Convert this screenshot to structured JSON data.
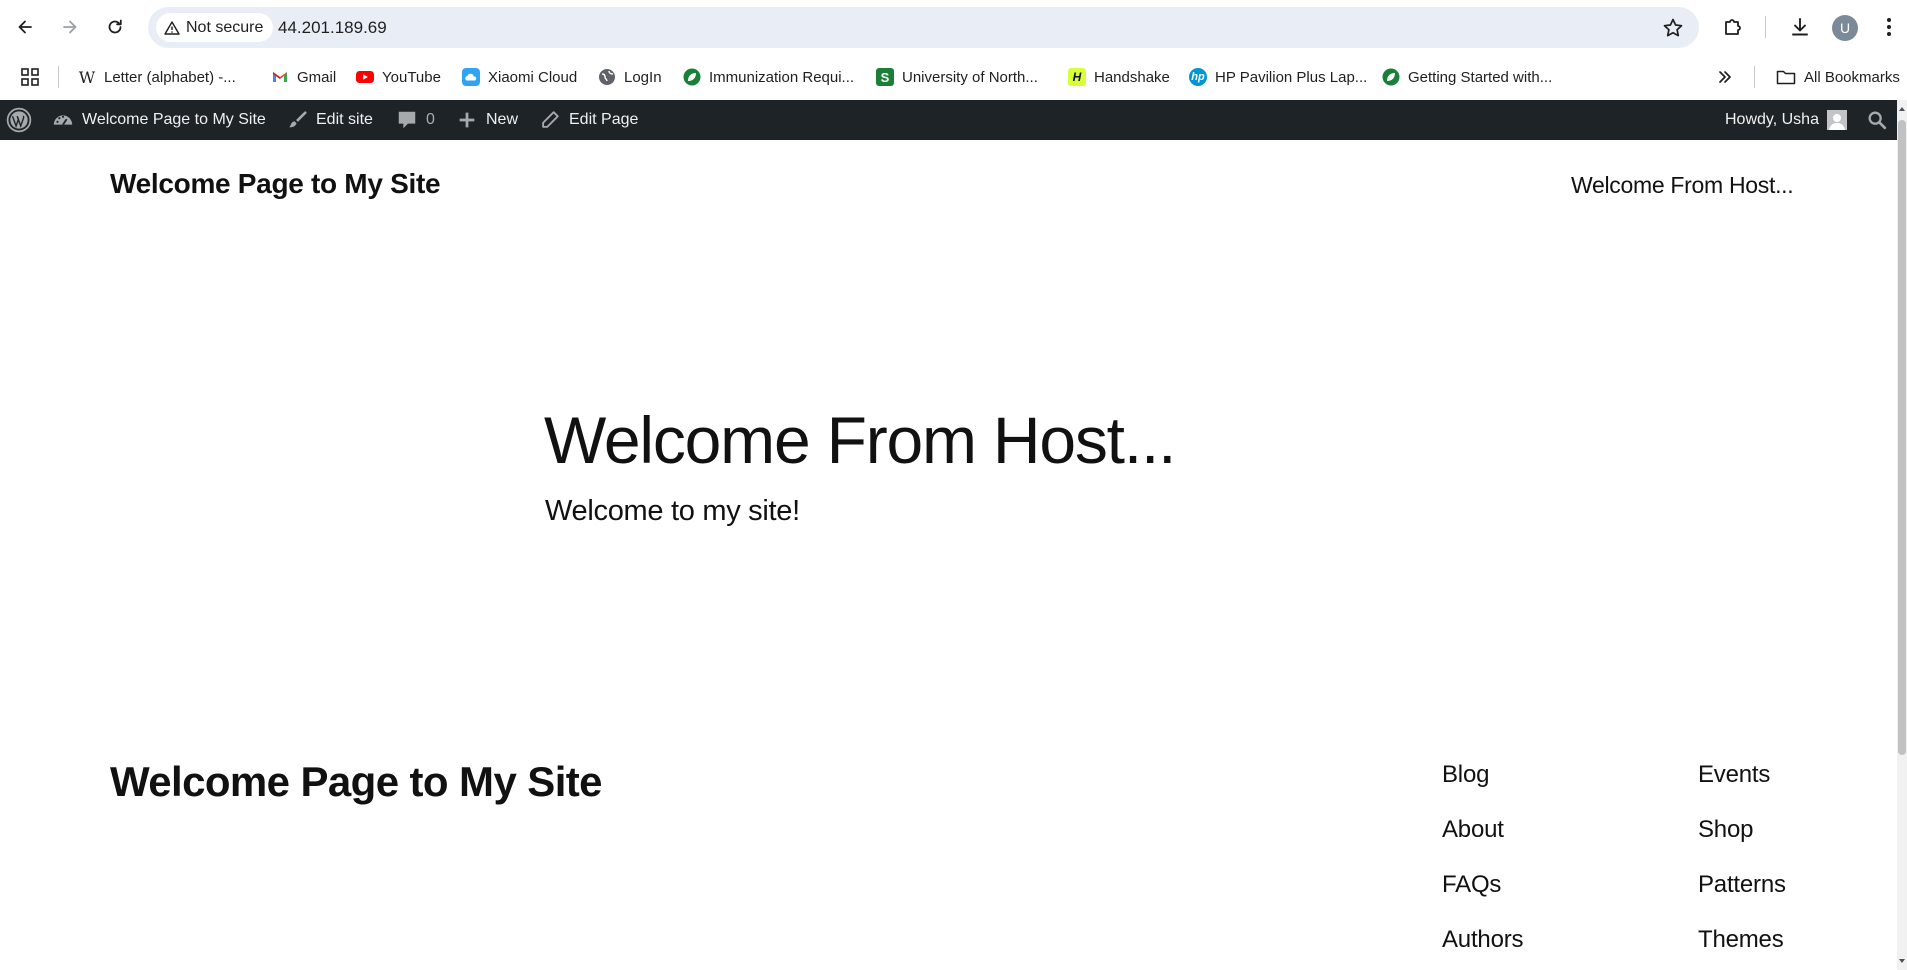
{
  "browser": {
    "security_label": "Not secure",
    "url": "44.201.189.69",
    "avatar_letter": "U"
  },
  "bookmarks": {
    "items": [
      {
        "label": "Letter (alphabet) -...",
        "icon": "wikipedia-icon"
      },
      {
        "label": "Gmail",
        "icon": "gmail-icon"
      },
      {
        "label": "YouTube",
        "icon": "youtube-icon"
      },
      {
        "label": "Xiaomi Cloud",
        "icon": "xiaomi-cloud-icon"
      },
      {
        "label": "LogIn",
        "icon": "globe-icon"
      },
      {
        "label": "Immunization Requi...",
        "icon": "leaf-icon"
      },
      {
        "label": "University of North...",
        "icon": "university-icon"
      },
      {
        "label": "Handshake",
        "icon": "handshake-icon"
      },
      {
        "label": "HP Pavilion Plus Lap...",
        "icon": "hp-icon"
      },
      {
        "label": "Getting Started with...",
        "icon": "leaf-icon"
      }
    ],
    "all_bookmarks": "All Bookmarks"
  },
  "adminbar": {
    "site_name": "Welcome Page to My Site",
    "edit_site": "Edit site",
    "comments_count": "0",
    "new_label": "New",
    "edit_page": "Edit Page",
    "howdy": "Howdy, Usha"
  },
  "header": {
    "site_title": "Welcome Page to My Site",
    "nav_link": "Welcome From Host..."
  },
  "main": {
    "title": "Welcome From Host...",
    "text": "Welcome to my site!"
  },
  "footer": {
    "site_title": "Welcome Page to My Site",
    "col1": [
      "Blog",
      "About",
      "FAQs",
      "Authors"
    ],
    "col2": [
      "Events",
      "Shop",
      "Patterns",
      "Themes"
    ]
  },
  "colors": {
    "adminbar_bg": "#1d2327",
    "omnibox_bg": "#e9eef6",
    "text": "#111111"
  }
}
